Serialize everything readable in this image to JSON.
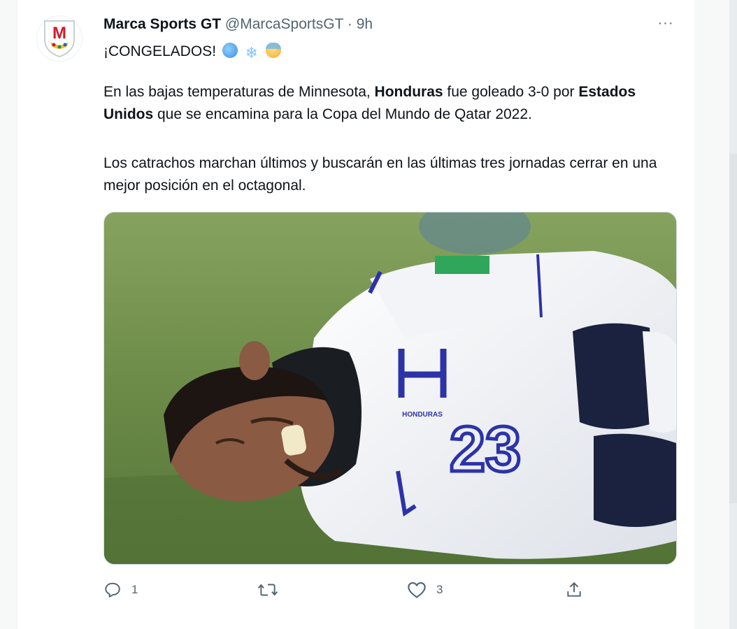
{
  "tweet": {
    "display_name": "Marca Sports GT",
    "handle": "@MarcaSportsGT",
    "separator": "·",
    "time": "9h",
    "more_label": "···",
    "text_line1": "¡CONGELADOS!",
    "emojis": [
      "cold-face-emoji",
      "snowflake-emoji",
      "anxious-face-emoji"
    ],
    "para2_a": "En las bajas temperaturas de Minnesota, ",
    "para2_b": "Honduras",
    "para2_c": " fue goleado 3-0 por ",
    "para2_d": "Estados Unidos",
    "para2_e": " que se encamina para la Copa del Mundo de Qatar 2022.",
    "para3": "Los catrachos marchan últimos y buscarán en las últimas tres jornadas cerrar en una mejor posición en el octagonal.",
    "avatar_letter": "M",
    "jersey_number": "23",
    "jersey_brand": "HONDURAS",
    "actions": {
      "reply_count": "1",
      "retweet_count": "",
      "like_count": "3"
    }
  },
  "colors": {
    "text": "#0f1419",
    "secondary": "#536471",
    "brand_red": "#d4182b",
    "jersey_blue": "#2c33a8"
  },
  "icons": [
    "more-icon",
    "reply-icon",
    "retweet-icon",
    "like-icon",
    "share-icon"
  ]
}
